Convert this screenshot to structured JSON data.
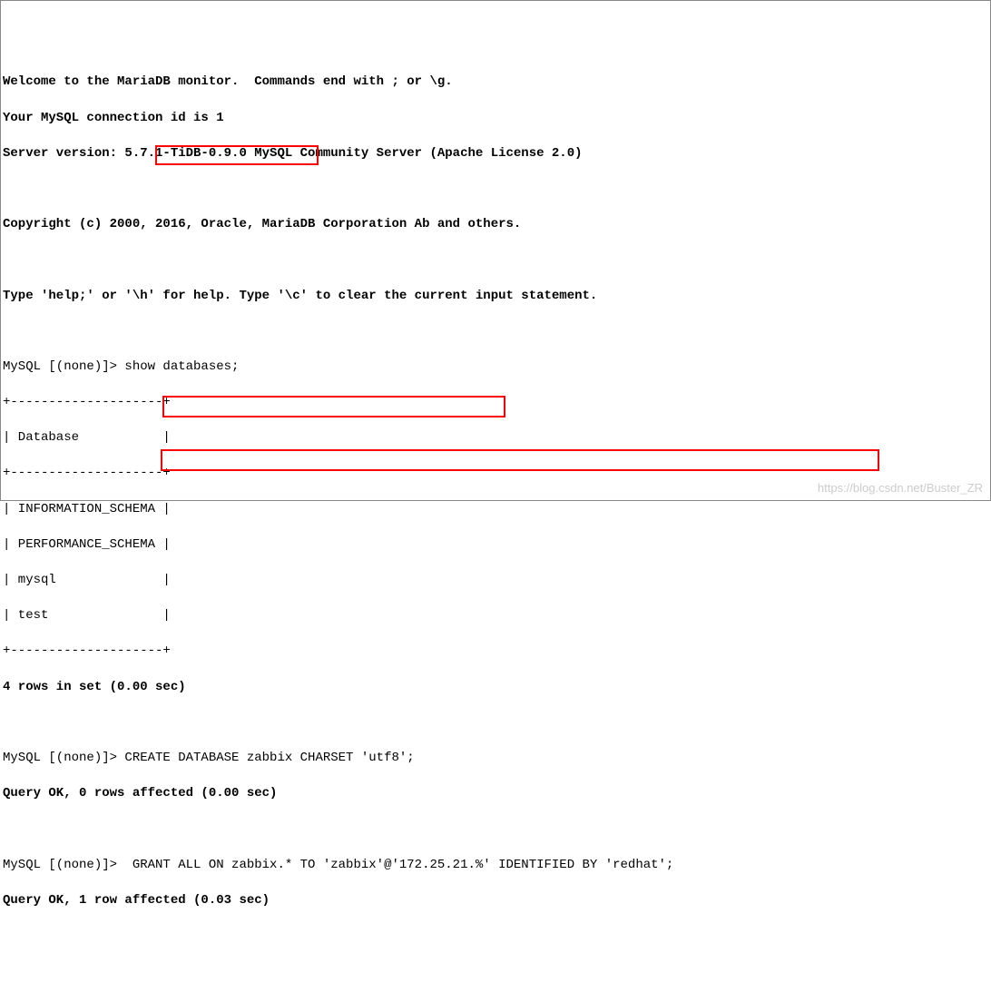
{
  "intro": {
    "line1": "Welcome to the MariaDB monitor.  Commands end with ; or \\g.",
    "line2": "Your MySQL connection id is 1",
    "line3": "Server version: 5.7.1-TiDB-0.9.0 MySQL Community Server (Apache License 2.0)",
    "copyright": "Copyright (c) 2000, 2016, Oracle, MariaDB Corporation Ab and others.",
    "help": "Type 'help;' or '\\h' for help. Type '\\c' to clear the current input statement."
  },
  "prompt": "MySQL [(none)]> ",
  "commands": {
    "show_db": "show databases;",
    "create_db": "CREATE DATABASE zabbix CHARSET 'utf8';",
    "grant": " GRANT ALL ON zabbix.* TO 'zabbix'@'172.25.21.%' IDENTIFIED BY 'redhat';"
  },
  "db_table": {
    "border": "+--------------------+",
    "header": "| Database           |",
    "rows": [
      "| INFORMATION_SCHEMA |",
      "| PERFORMANCE_SCHEMA |",
      "| mysql              |",
      "| test               |"
    ]
  },
  "results": {
    "rows_in_set": "4 rows in set (0.00 sec)",
    "query_ok_0": "Query OK, 0 rows affected (0.00 sec)",
    "query_ok_1": "Query OK, 1 row affected (0.03 sec)"
  },
  "watermark": "https://blog.csdn.net/Buster_ZR"
}
